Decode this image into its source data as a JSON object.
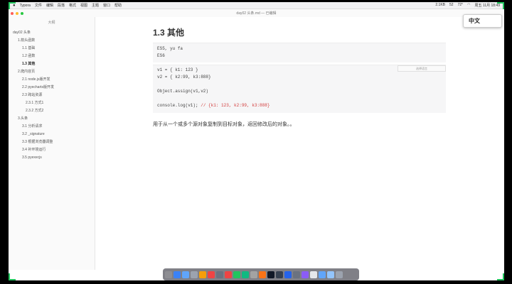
{
  "menubar": {
    "app": "Typora",
    "items": [
      "文件",
      "编辑",
      "段落",
      "格式",
      "视图",
      "主题",
      "窗口",
      "帮助"
    ],
    "right_status": [
      "2.1KB",
      "52",
      "72°"
    ],
    "clock": "周五 11月 18:49"
  },
  "window": {
    "title": "day02 头条.md — 已编辑"
  },
  "sidebar": {
    "title": "大纲",
    "items": [
      {
        "label": "day02 头条",
        "level": 0,
        "active": false
      },
      {
        "label": "1.箭头函数",
        "level": 1,
        "active": false
      },
      {
        "label": "1.1 基础",
        "level": 2,
        "active": false
      },
      {
        "label": "1.2 函数",
        "level": 2,
        "active": false
      },
      {
        "label": "1.3 其他",
        "level": 2,
        "active": true
      },
      {
        "label": "2.爬内容页",
        "level": 1,
        "active": false
      },
      {
        "label": "2.1 node.js版开发",
        "level": 2,
        "active": false
      },
      {
        "label": "2.2 pyecharts版开发",
        "level": 2,
        "active": false
      },
      {
        "label": "2.3 跨站资源",
        "level": 2,
        "active": false
      },
      {
        "label": "2.3.1 方式1",
        "level": 3,
        "active": false
      },
      {
        "label": "2.3.2 方式2",
        "level": 3,
        "active": false
      },
      {
        "label": "3.头条",
        "level": 1,
        "active": false
      },
      {
        "label": "3.1 分析请求",
        "level": 2,
        "active": false
      },
      {
        "label": "3.2 _signature",
        "level": 2,
        "active": false
      },
      {
        "label": "3.3 根据浏览器调整",
        "level": 2,
        "active": false
      },
      {
        "label": "3.4 补环境运行",
        "level": 2,
        "active": false
      },
      {
        "label": "3.5 pyexecjs",
        "level": 2,
        "active": false
      }
    ]
  },
  "editor": {
    "heading": "1.3 其他",
    "code1_lines": [
      "ES5, yu fa",
      "ES6"
    ],
    "code2_lines": [
      {
        "text": "v1 = { k1: 123 }",
        "comment": ""
      },
      {
        "text": "v2 = { k2:99, k3:888}",
        "comment": ""
      },
      {
        "text": "",
        "comment": ""
      },
      {
        "text": "Object.assign(v1,v2)",
        "comment": ""
      },
      {
        "text": "",
        "comment": ""
      },
      {
        "text": "console.log(v1); ",
        "comment": "// {k1: 123, k2:99, k3:888}"
      }
    ],
    "lang_placeholder": "选择语言",
    "paragraph": "用于从一个或多个源对象复制到目标对象，返回修改后的对象。。"
  },
  "ime": {
    "label": "中文"
  },
  "dock": {
    "colors": [
      "#8e8e93",
      "#3b82f6",
      "#60a5fa",
      "#9ca3af",
      "#f59e0b",
      "#ef4444",
      "#6b7280",
      "#ef4444",
      "#22c55e",
      "#10b981",
      "#a3a3a3",
      "#f97316",
      "#111827",
      "#374151",
      "#2563eb",
      "#6b7280",
      "#8b5cf6",
      "#e5e7eb",
      "#60a5fa",
      "#93c5fd",
      "#9ca3af"
    ]
  }
}
